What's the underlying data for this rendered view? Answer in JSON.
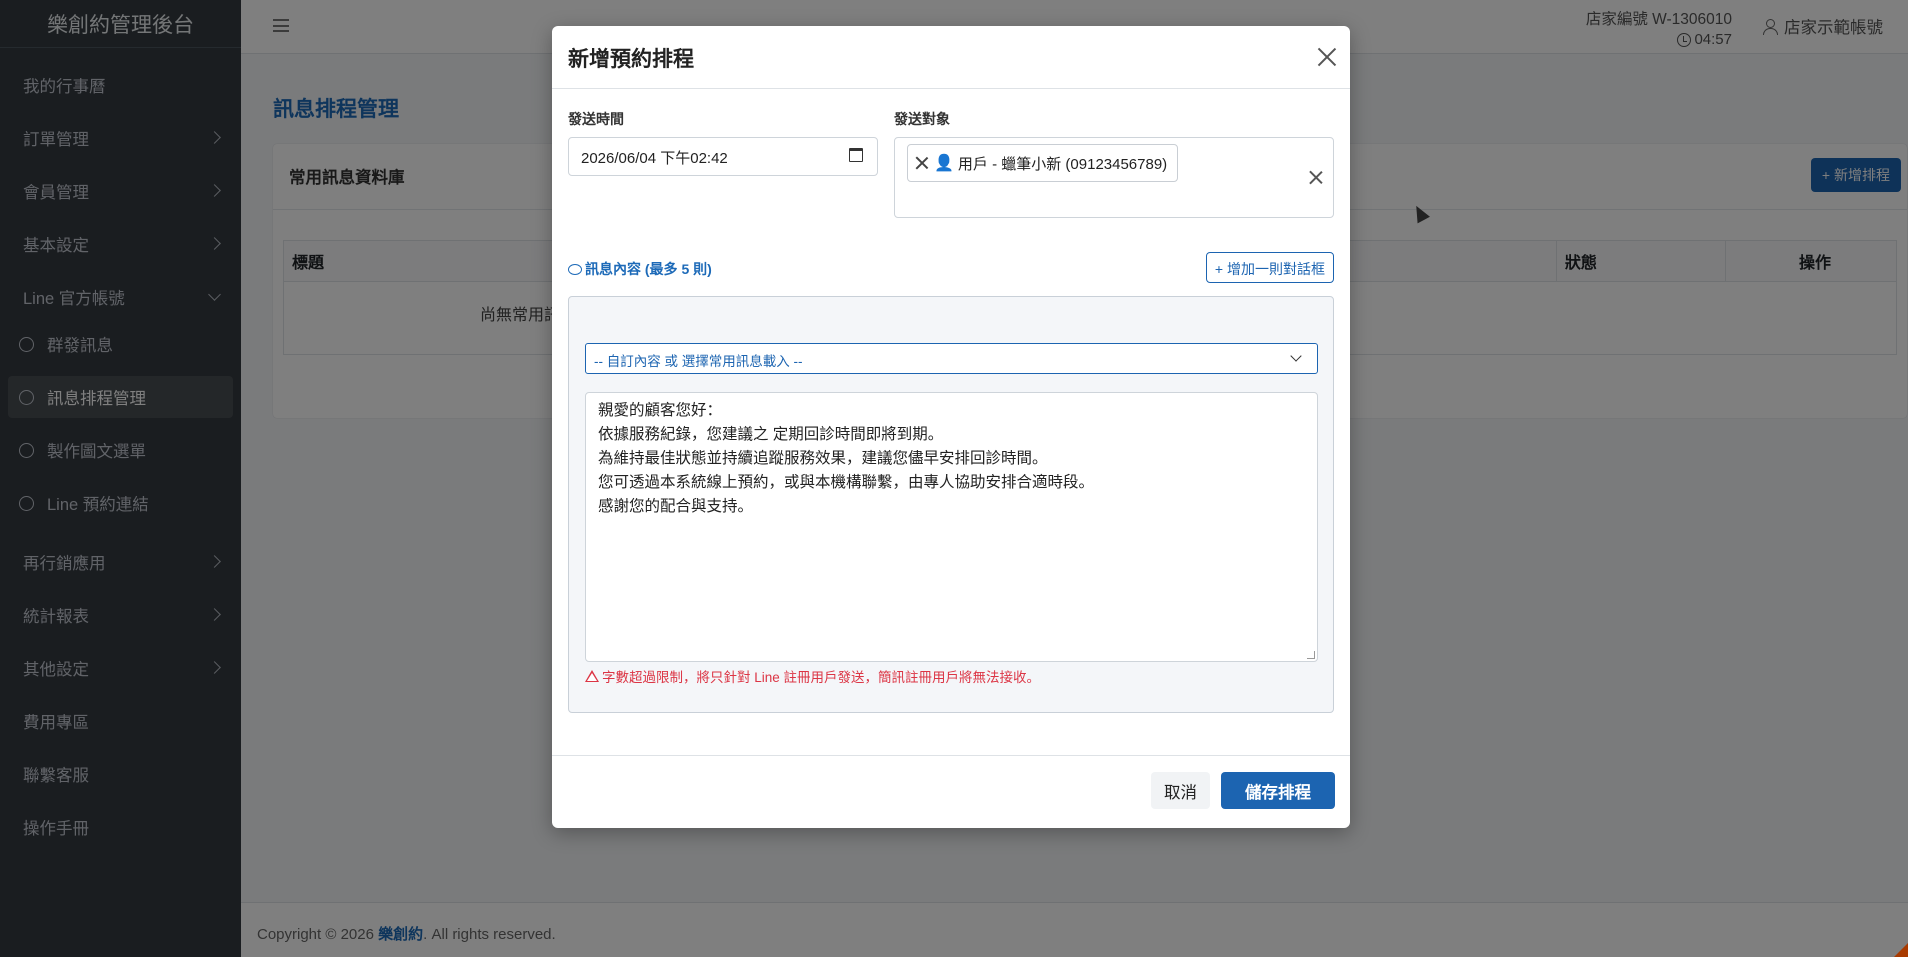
{
  "sidebar": {
    "brand": "樂創約管理後台",
    "items": [
      {
        "label": "我的行事曆"
      },
      {
        "label": "訂單管理"
      },
      {
        "label": "會員管理"
      },
      {
        "label": "基本設定"
      },
      {
        "label": "Line 官方帳號"
      }
    ],
    "sub_items": [
      {
        "label": "群發訊息"
      },
      {
        "label": "訊息排程管理"
      },
      {
        "label": "製作圖文選單"
      },
      {
        "label": "Line 預約連結"
      }
    ],
    "items_after": [
      {
        "label": "再行銷應用"
      },
      {
        "label": "統計報表"
      },
      {
        "label": "其他設定"
      },
      {
        "label": "費用專區"
      },
      {
        "label": "聯繫客服"
      },
      {
        "label": "操作手冊"
      }
    ]
  },
  "topbar": {
    "shop_no": "店家編號 W-1306010",
    "time": "04:57",
    "account": "店家示範帳號"
  },
  "main": {
    "page_title": "訊息排程管理",
    "card_title": "常用訊息資料庫",
    "new_schedule_btn": "+ 新增排程",
    "columns": [
      "標題",
      "狀態",
      "操作"
    ],
    "empty_text": "尚無常用訊"
  },
  "footer": {
    "prefix": "Copyright © 2026 ",
    "brand": "樂創約",
    "suffix": ". All rights reserved."
  },
  "modal": {
    "title": "新增預約排程",
    "send_time_label": "發送時間",
    "send_time_value": "2026/06/04 下午02:42",
    "target_label": "發送對象",
    "target_chip": "用戶 - 蠟筆小新 (09123456789)",
    "message_label": "訊息內容 (最多 5 則)",
    "add_dialog_btn": "+ 增加一則對話框",
    "select_placeholder": "-- 自訂內容 或 選擇常用訊息載入 --",
    "message_lines": [
      "親愛的顧客您好：",
      "依據服務紀錄，您建議之 定期回診時間即將到期。",
      "為維持最佳狀態並持續追蹤服務效果，建議您儘早安排回診時間。",
      "您可透過本系統線上預約，或與本機構聯繫，由專人協助安排合適時段。",
      "感謝您的配合與支持。"
    ],
    "warning": "字數超過限制，將只針對 Line 註冊用戶發送，簡訊註冊用戶將無法接收。",
    "cancel_btn": "取消",
    "save_btn": "儲存排程"
  },
  "colors": {
    "sidebar_bg": "#343a40",
    "accent": "#1c64b1",
    "danger": "#dc3545"
  }
}
